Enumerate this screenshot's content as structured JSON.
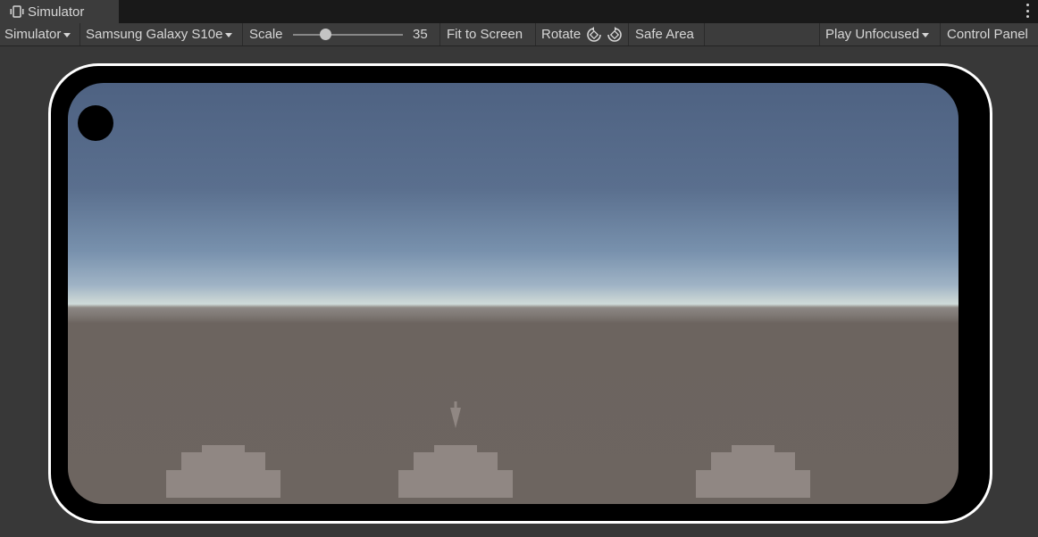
{
  "window": {
    "tab_label": "Simulator",
    "tab_icon": "simulator-device-icon",
    "menu_icon": "kebab-menu-icon"
  },
  "toolbar": {
    "mode_dropdown": "Simulator",
    "device_dropdown": "Samsung Galaxy S10e",
    "scale_label": "Scale",
    "scale_value": "35",
    "fit_to_screen": "Fit to Screen",
    "rotate_label": "Rotate",
    "rotate_left_icon": "rotate-counterclockwise-icon",
    "rotate_right_icon": "rotate-clockwise-icon",
    "safe_area": "Safe Area",
    "play_mode_dropdown": "Play Unfocused",
    "control_panel": "Control Panel"
  },
  "colors": {
    "sky_top": "#4e6282",
    "horizon": "#cfdad8",
    "ground": "#6d6560",
    "bunker": "#908783",
    "device_bezel": "#000000",
    "device_outline": "#ffffff"
  },
  "scene": {
    "objects": [
      "player-cannon",
      "bunker-left",
      "bunker-center",
      "bunker-right"
    ]
  }
}
